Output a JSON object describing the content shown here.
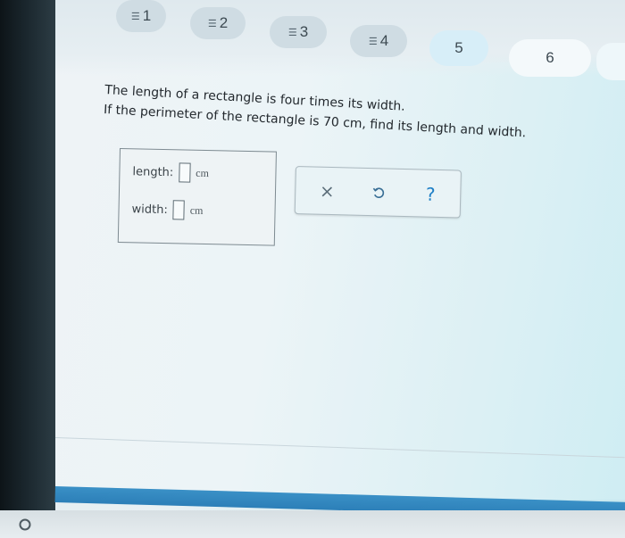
{
  "tabs": [
    {
      "label": "1",
      "status": "answered",
      "status_icon": "answered-icon"
    },
    {
      "label": "2",
      "status": "answered",
      "status_icon": "answered-icon"
    },
    {
      "label": "3",
      "status": "answered",
      "status_icon": "answered-icon"
    },
    {
      "label": "4",
      "status": "answered",
      "status_icon": "answered-icon"
    },
    {
      "label": "5",
      "status": "current"
    },
    {
      "label": "6",
      "status": "unanswered"
    }
  ],
  "question": {
    "line1": "The length of a rectangle is four times its width.",
    "line2": "If the perimeter of the rectangle is 70 cm, find its length and width."
  },
  "answer": {
    "length_label": "length:",
    "length_value": "",
    "length_unit": "cm",
    "width_label": "width:",
    "width_value": "",
    "width_unit": "cm"
  },
  "actions": [
    {
      "name": "clear",
      "icon": "close-icon"
    },
    {
      "name": "undo",
      "icon": "undo-icon"
    },
    {
      "name": "help",
      "icon": "help-icon",
      "glyph": "?"
    }
  ],
  "colors": {
    "help_blue": "#1e7fc6",
    "bottom_bar": "#2c7fb8",
    "tab_bg": "#cfdce3"
  },
  "taskbar": {
    "launcher_icon": "launcher-circle-icon"
  }
}
